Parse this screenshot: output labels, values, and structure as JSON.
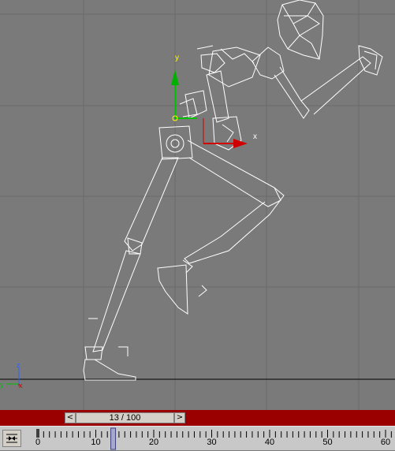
{
  "viewport": {
    "background": "#7a7a7a",
    "gizmo": {
      "x_label": "x",
      "y_label": "y"
    },
    "axis_tripod": {
      "x_label": "x",
      "y_label": "y",
      "z_label": "z"
    }
  },
  "time_slider": {
    "frame_text": "13 / 100",
    "prev_label": "<",
    "next_label": ">",
    "bar_color": "#9a0000"
  },
  "trackbar": {
    "icon": "key-filter-icon",
    "ticks": [
      "0",
      "10",
      "20",
      "30",
      "40",
      "50",
      "60"
    ],
    "current_frame": 13
  }
}
